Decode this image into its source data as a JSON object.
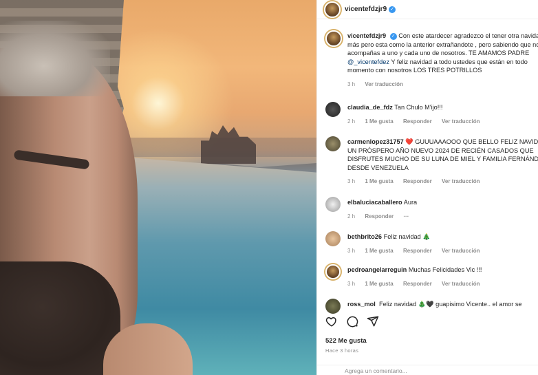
{
  "post": {
    "author": "vicentefdzjr9",
    "caption_username": "vicentefdzjr9",
    "caption_text": "Con este atardecer agradezco el tener otra navidad más pero esta como la anterior extrañandote , pero sabiendo que nos acompañas a uno y cada uno de nosotros. TE AMAMOS PADRE",
    "caption_mention": "@_vicentefdez",
    "caption_text_2": "Y feliz navidad a todo ustedes que están en todo momento con nosotros LOS TRES POTRILLOS",
    "caption_time": "3 h",
    "caption_translate": "Ver traducción",
    "likes": "522 Me gusta",
    "posted_ago": "Hace 3 horas",
    "add_comment_placeholder": "Agrega un comentario..."
  },
  "comments": [
    {
      "user": "claudia_de_fdz",
      "text": "Tan Chulo M'ijo!!!",
      "time": "2 h",
      "likes": "1 Me gusta",
      "reply": "Responder",
      "translate": "Ver traducción"
    },
    {
      "user": "carmenlopez31757",
      "text": "❤️ GUUUAAAOOO QUE BELLO FELIZ NAVIDAD Y UN PRÓSPERO AÑO NUEVO 2024 DE RECIÉN CASADOS QUE DISFRUTES MUCHO DE SU LUNA DE MIEL Y FAMILIA FERNÁNDEZ DESDE VENEZUELA",
      "time": "3 h",
      "likes": "1 Me gusta",
      "reply": "Responder",
      "translate": "Ver traducción"
    },
    {
      "user": "elbaluciacaballero",
      "text": "Aura",
      "time": "2 h",
      "reply": "Responder",
      "more": "···"
    },
    {
      "user": "bethbrito26",
      "text": "Feliz navidad 🎄",
      "time": "3 h",
      "likes": "1 Me gusta",
      "reply": "Responder",
      "translate": "Ver traducción"
    },
    {
      "user": "pedroangelarreguin",
      "text": "Muchas Felicidades Vic !!!",
      "time": "3 h",
      "likes": "1 Me gusta",
      "reply": "Responder",
      "translate": "Ver traducción"
    },
    {
      "user": "ross_mol",
      "text": "Feliz navidad 🎄🖤 guapisimo Vicente.. el amor se"
    }
  ]
}
